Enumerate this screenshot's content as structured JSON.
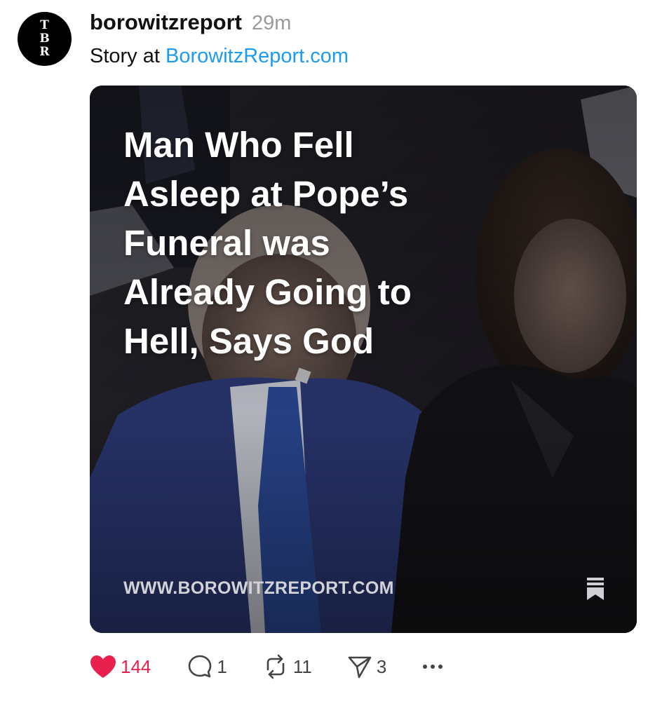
{
  "post": {
    "avatar_letters": [
      "T",
      "B",
      "R"
    ],
    "username": "borowitzreport",
    "time": "29m",
    "caption_prefix": "Story at",
    "caption_link": "BorowitzReport.com"
  },
  "card": {
    "headline": "Man Who Fell\nAsleep at Pope’s\nFuneral was\nAlready Going to\nHell, Says God",
    "domain": "WWW.BOROWITZREPORT.COM",
    "bookmark_icon": "bookmark-icon"
  },
  "actions": {
    "like_count": "144",
    "reply_count": "1",
    "repost_count": "11",
    "share_count": "3",
    "icons": {
      "like": "heart-icon",
      "reply": "comment-icon",
      "repost": "repost-icon",
      "share": "send-icon",
      "more": "more-icon"
    }
  },
  "colors": {
    "link": "#1d9bf0",
    "like_active": "#e8204e",
    "username": "#111111",
    "timestamp": "#9a9a9a"
  }
}
